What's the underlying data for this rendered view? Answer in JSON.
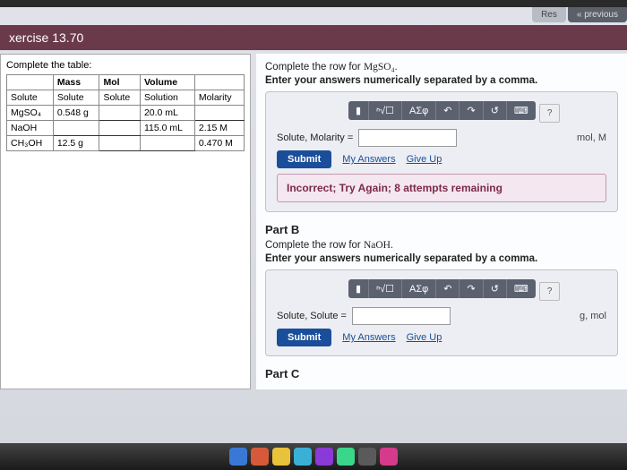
{
  "tabs": {
    "res": "Res",
    "prev": "« previous"
  },
  "exercise": "xercise 13.70",
  "left": {
    "title": "Complete the table:",
    "head": [
      "",
      "Mass",
      "Mol",
      "Volume",
      ""
    ],
    "sub": [
      "Solute",
      "Solute",
      "Solute",
      "Solution",
      "Molarity"
    ],
    "rows": [
      {
        "name": "MgSO₄",
        "mass": "0.548 g",
        "mol": "",
        "vol": "20.0 mL",
        "molarity": ""
      },
      {
        "name": "NaOH",
        "mass": "",
        "mol": "",
        "vol": "115.0 mL",
        "molarity": "2.15 M"
      },
      {
        "name": "CH₃OH",
        "mass": "12.5 g",
        "mol": "",
        "vol": "",
        "molarity": "0.470 M"
      }
    ]
  },
  "partA": {
    "l1a": "Complete the row for ",
    "l1b": "MgSO₄.",
    "l2": "Enter your answers numerically separated by a comma.",
    "tb": {
      "root": "ⁿ√☐",
      "greek": "ΑΣφ",
      "undo": "↶",
      "redo": "↷",
      "reset": "↺",
      "kb": "⌨",
      "q": "?"
    },
    "label": "Solute, Molarity =",
    "units": "mol, M",
    "submit": "Submit",
    "mya": "My Answers",
    "gu": "Give Up",
    "fb": "Incorrect; Try Again; 8 attempts remaining"
  },
  "partB": {
    "head": "Part B",
    "l1a": "Complete the row for ",
    "l1b": "NaOH.",
    "l2": "Enter your answers numerically separated by a comma.",
    "label": "Solute, Solute =",
    "units": "g, mol",
    "submit": "Submit",
    "mya": "My Answers",
    "gu": "Give Up"
  },
  "partC": {
    "head": "Part C"
  }
}
